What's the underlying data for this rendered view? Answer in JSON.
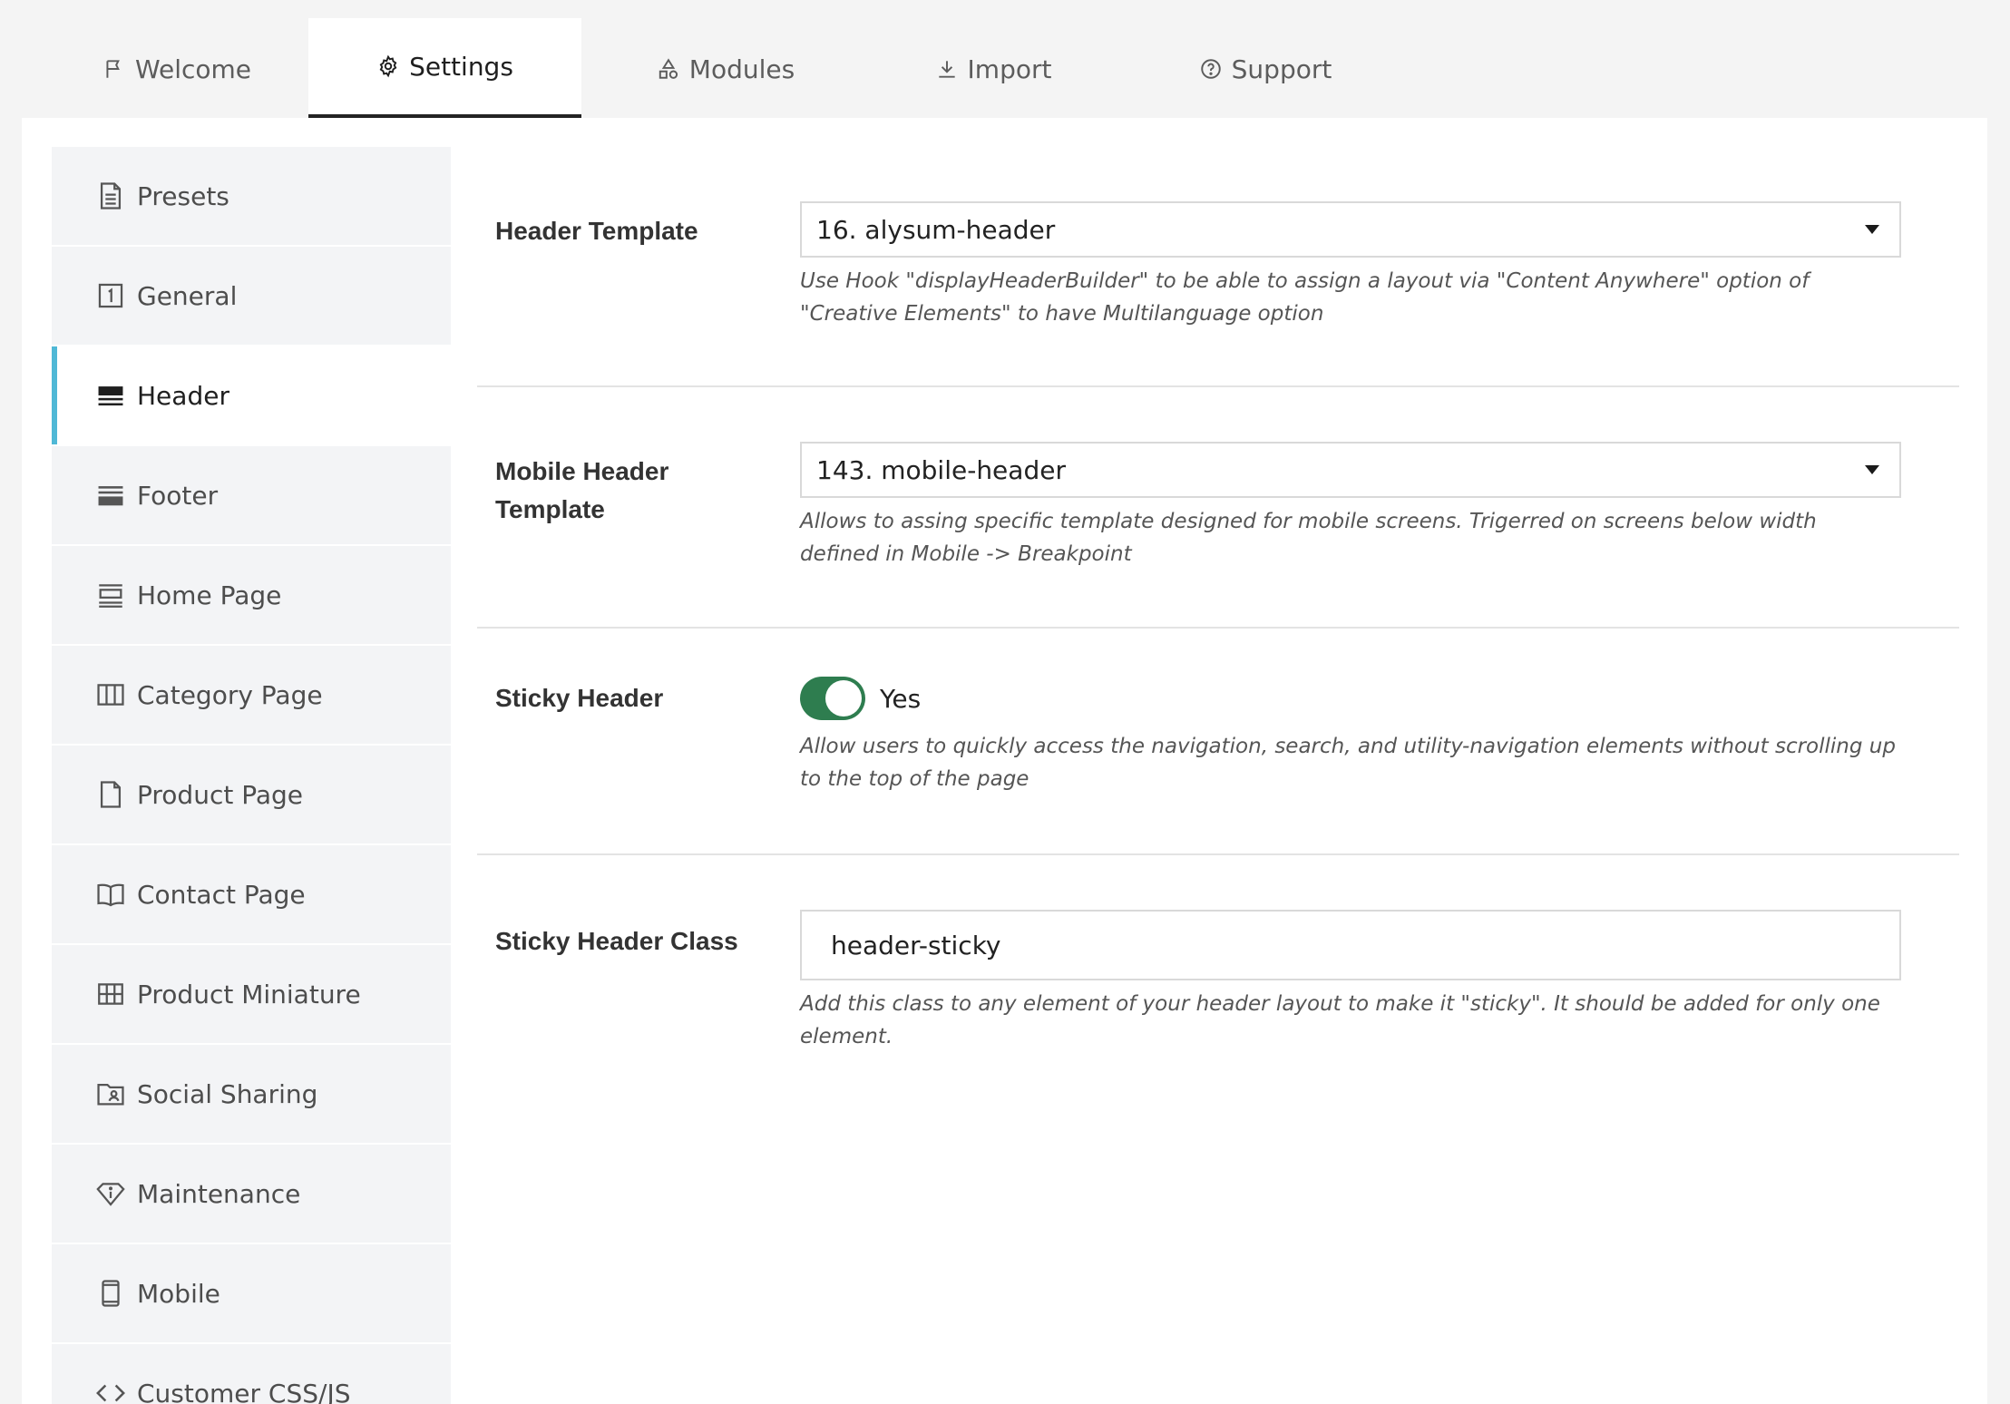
{
  "tabs": [
    {
      "label": "Welcome",
      "icon": "flag-icon",
      "active": false
    },
    {
      "label": "Settings",
      "icon": "gear-icon",
      "active": true
    },
    {
      "label": "Modules",
      "icon": "shapes-icon",
      "active": false
    },
    {
      "label": "Import",
      "icon": "download-icon",
      "active": false
    },
    {
      "label": "Support",
      "icon": "question-circle-icon",
      "active": false
    }
  ],
  "sidebar": {
    "active_color": "#4fb8d6",
    "items": [
      {
        "label": "Presets",
        "icon": "document-icon"
      },
      {
        "label": "General",
        "icon": "square-one-icon"
      },
      {
        "label": "Header",
        "icon": "header-bars-icon",
        "active": true
      },
      {
        "label": "Footer",
        "icon": "footer-bars-icon"
      },
      {
        "label": "Home Page",
        "icon": "home-layout-icon"
      },
      {
        "label": "Category Page",
        "icon": "columns-icon"
      },
      {
        "label": "Product Page",
        "icon": "page-icon"
      },
      {
        "label": "Contact Page",
        "icon": "book-icon"
      },
      {
        "label": "Product Miniature",
        "icon": "grid-icon"
      },
      {
        "label": "Social Sharing",
        "icon": "folder-user-icon"
      },
      {
        "label": "Maintenance",
        "icon": "diamond-info-icon"
      },
      {
        "label": "Mobile",
        "icon": "mobile-icon"
      },
      {
        "label": "Customer CSS/JS",
        "icon": "code-icon"
      }
    ]
  },
  "form": {
    "header_template": {
      "label": "Header Template",
      "value": "16. alysum-header",
      "help": "Use Hook \"displayHeaderBuilder\" to be able to assign a layout via \"Content Anywhere\" option of \"Creative Elements\" to have Multilanguage option"
    },
    "mobile_header_template": {
      "label_line1": "Mobile Header",
      "label_line2": "Template",
      "value": "143. mobile-header",
      "help": "Allows to assing specific template designed for mobile screens. Trigerred on screens below width defined in Mobile -> Breakpoint"
    },
    "sticky_header": {
      "label": "Sticky Header",
      "toggle_text": "Yes",
      "enabled": true,
      "toggle_color": "#2e7d4f",
      "help": "Allow users to quickly access the navigation, search, and utility-navigation elements without scrolling up to the top of the page"
    },
    "sticky_header_class": {
      "label": "Sticky Header Class",
      "value": "header-sticky",
      "help": "Add this class to any element of your header layout to make it \"sticky\". It should be added for only one element."
    }
  }
}
